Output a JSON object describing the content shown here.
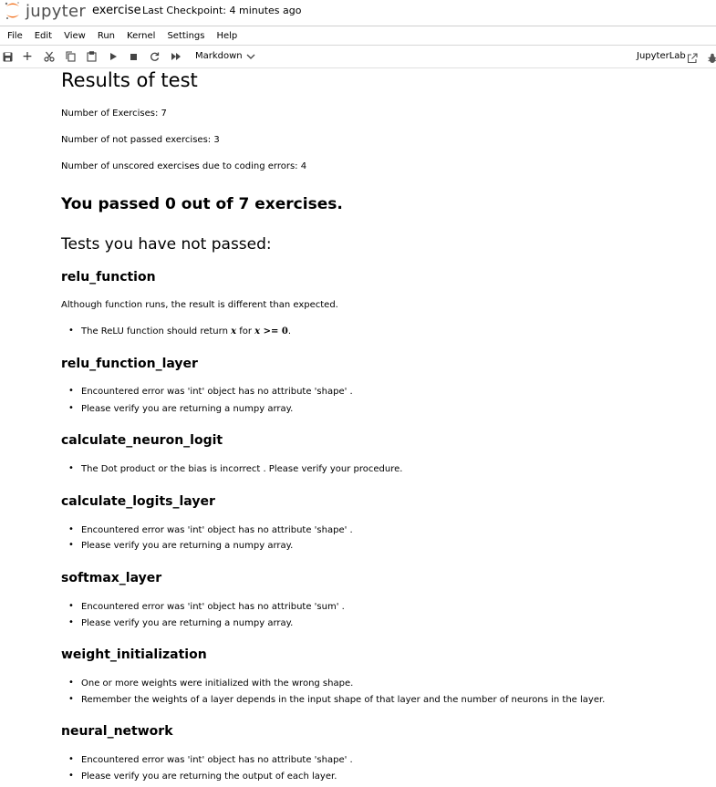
{
  "topbar": {
    "logo_text": "jupyter",
    "notebook_name": "exercise",
    "checkpoint": "Last Checkpoint: 4 minutes ago"
  },
  "menu": [
    "File",
    "Edit",
    "View",
    "Run",
    "Kernel",
    "Settings",
    "Help"
  ],
  "toolbar": {
    "cell_type": "Markdown",
    "jupyterlab_label": "JupyterLab",
    "icons": [
      "save-icon",
      "add-icon",
      "cut-icon",
      "copy-icon",
      "paste-icon",
      "run-icon",
      "stop-icon",
      "restart-icon",
      "fast-forward-icon",
      "chevron-down-icon",
      "external-link-icon",
      "bug-icon"
    ]
  },
  "colors": {
    "logo_orange": "#f37726",
    "text": "#000000"
  },
  "results": {
    "title": "Results of test",
    "stats": [
      "Number of Exercises: 7",
      "Number of not passed exercises: 3",
      "Number of unscored exercises due to coding errors: 4"
    ],
    "summary": "You passed 0 out of 7 exercises.",
    "failed_heading": "Tests you have not passed:",
    "relu_function": {
      "title": "relu_function",
      "note": "Although function runs, the result is different than expected.",
      "bullet_prefix": "The ReLU function should return ",
      "bullet_x1": "x",
      "bullet_for": " for ",
      "bullet_x2": "x",
      "bullet_cond": " >= 0",
      "bullet_end": "."
    },
    "sections": [
      {
        "title": "relu_function_layer",
        "bullets": [
          "Encountered error was 'int' object has no attribute 'shape' .",
          "Please verify you are returning a numpy array."
        ]
      },
      {
        "title": "calculate_neuron_logit",
        "bullets": [
          "The Dot product or the bias is incorrect . Please verify your procedure."
        ]
      },
      {
        "title": "calculate_logits_layer",
        "bullets": [
          "Encountered error was 'int' object has no attribute 'shape' .",
          "Please verify you are returning a numpy array."
        ]
      },
      {
        "title": "softmax_layer",
        "bullets": [
          "Encountered error was 'int' object has no attribute 'sum' .",
          "Please verify you are returning a numpy array."
        ]
      },
      {
        "title": "weight_initialization",
        "bullets": [
          "One or more weights were initialized with the wrong shape.",
          "Remember the weights of a layer depends in the input shape of that layer and the number of neurons in the layer."
        ]
      },
      {
        "title": "neural_network",
        "bullets": [
          "Encountered error was 'int' object has no attribute 'shape' .",
          "Please verify you are returning the output of each layer."
        ]
      }
    ]
  }
}
